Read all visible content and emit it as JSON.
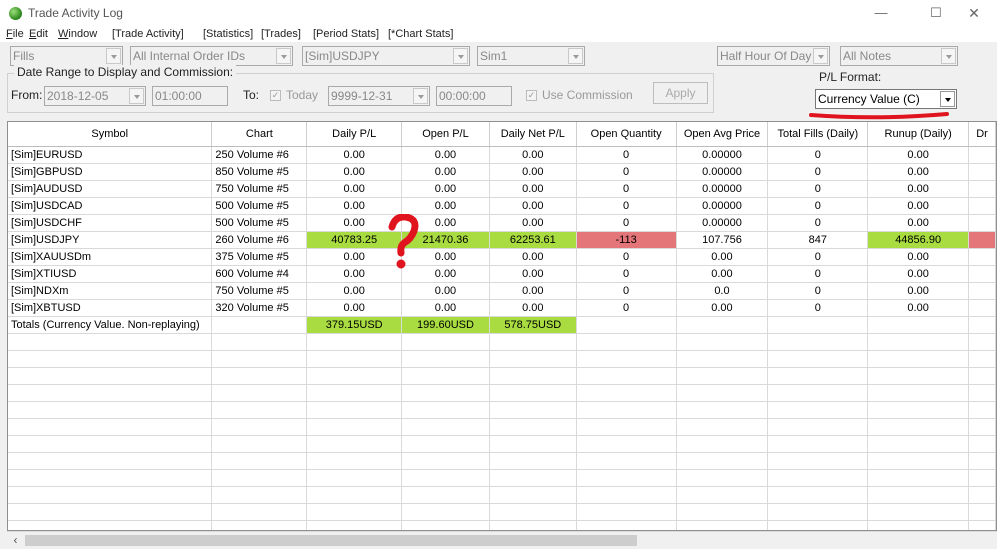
{
  "window": {
    "title": "Trade Activity Log"
  },
  "menu": [
    "File",
    "Edit",
    "Window",
    "[Trade Activity]",
    "[Statistics]",
    "[Trades]",
    "[Period Stats]",
    "[*Chart Stats]"
  ],
  "filters": {
    "fills": "Fills",
    "order_ids": "All Internal Order IDs",
    "symbol": "[Sim]USDJPY",
    "account": "Sim1",
    "period": "Half Hour Of Day",
    "notes": "All Notes"
  },
  "date_range": {
    "title": "Date Range to Display and Commission:",
    "from_label": "From:",
    "from_date": "2018-12-05",
    "from_time": "01:00:00",
    "to_label": "To:",
    "today_label": "Today",
    "to_date": "9999-12-31",
    "to_time": "00:00:00",
    "use_commission_label": "Use Commission",
    "apply_label": "Apply"
  },
  "pl_format": {
    "label": "P/L Format:",
    "value": "Currency Value (C)"
  },
  "annotation": {
    "question_mark_color": "#e0141e",
    "underline_color": "#e0141e"
  },
  "grid": {
    "columns": [
      "Symbol",
      "Chart",
      "Daily P/L",
      "Open P/L",
      "Daily Net P/L",
      "Open Quantity",
      "Open Avg Price",
      "Total Fills (Daily)",
      "Runup (Daily)",
      "Dr"
    ],
    "rows": [
      [
        "[Sim]EURUSD",
        "250 Volume  #6",
        "0.00",
        "0.00",
        "0.00",
        "0",
        "0.00000",
        "0",
        "0.00",
        ""
      ],
      [
        "[Sim]GBPUSD",
        "850 Volume  #5",
        "0.00",
        "0.00",
        "0.00",
        "0",
        "0.00000",
        "0",
        "0.00",
        ""
      ],
      [
        "[Sim]AUDUSD",
        "750 Volume  #5",
        "0.00",
        "0.00",
        "0.00",
        "0",
        "0.00000",
        "0",
        "0.00",
        ""
      ],
      [
        "[Sim]USDCAD",
        "500 Volume  #5",
        "0.00",
        "0.00",
        "0.00",
        "0",
        "0.00000",
        "0",
        "0.00",
        ""
      ],
      [
        "[Sim]USDCHF",
        "500 Volume  #5",
        "0.00",
        "0.00",
        "0.00",
        "0",
        "0.00000",
        "0",
        "0.00",
        ""
      ],
      [
        "[Sim]USDJPY",
        "260 Volume  #6",
        "40783.25",
        "21470.36",
        "62253.61",
        "-113",
        "107.756",
        "847",
        "44856.90",
        ""
      ],
      [
        "[Sim]XAUUSDm",
        "375 Volume  #5",
        "0.00",
        "0.00",
        "0.00",
        "0",
        "0.00",
        "0",
        "0.00",
        ""
      ],
      [
        "[Sim]XTIUSD",
        "600 Volume  #4",
        "0.00",
        "0.00",
        "0.00",
        "0",
        "0.00",
        "0",
        "0.00",
        ""
      ],
      [
        "[Sim]NDXm",
        "750 Volume  #5",
        "0.00",
        "0.00",
        "0.00",
        "0",
        "0.0",
        "0",
        "0.00",
        ""
      ],
      [
        "[Sim]XBTUSD",
        "320 Volume  #5",
        "0.00",
        "0.00",
        "0.00",
        "0",
        "0.00",
        "0",
        "0.00",
        ""
      ],
      [
        "Totals (Currency Value. Non-replaying)",
        "",
        "379.15USD",
        "199.60USD",
        "578.75USD",
        "",
        "",
        "",
        "",
        ""
      ]
    ],
    "row_colors": {
      "5": {
        "2": "pos",
        "3": "pos",
        "4": "pos",
        "5": "neg",
        "8": "pos",
        "9": "neg"
      },
      "10": {
        "2": "pos",
        "3": "pos",
        "4": "pos"
      }
    },
    "empty_rows": 12
  }
}
